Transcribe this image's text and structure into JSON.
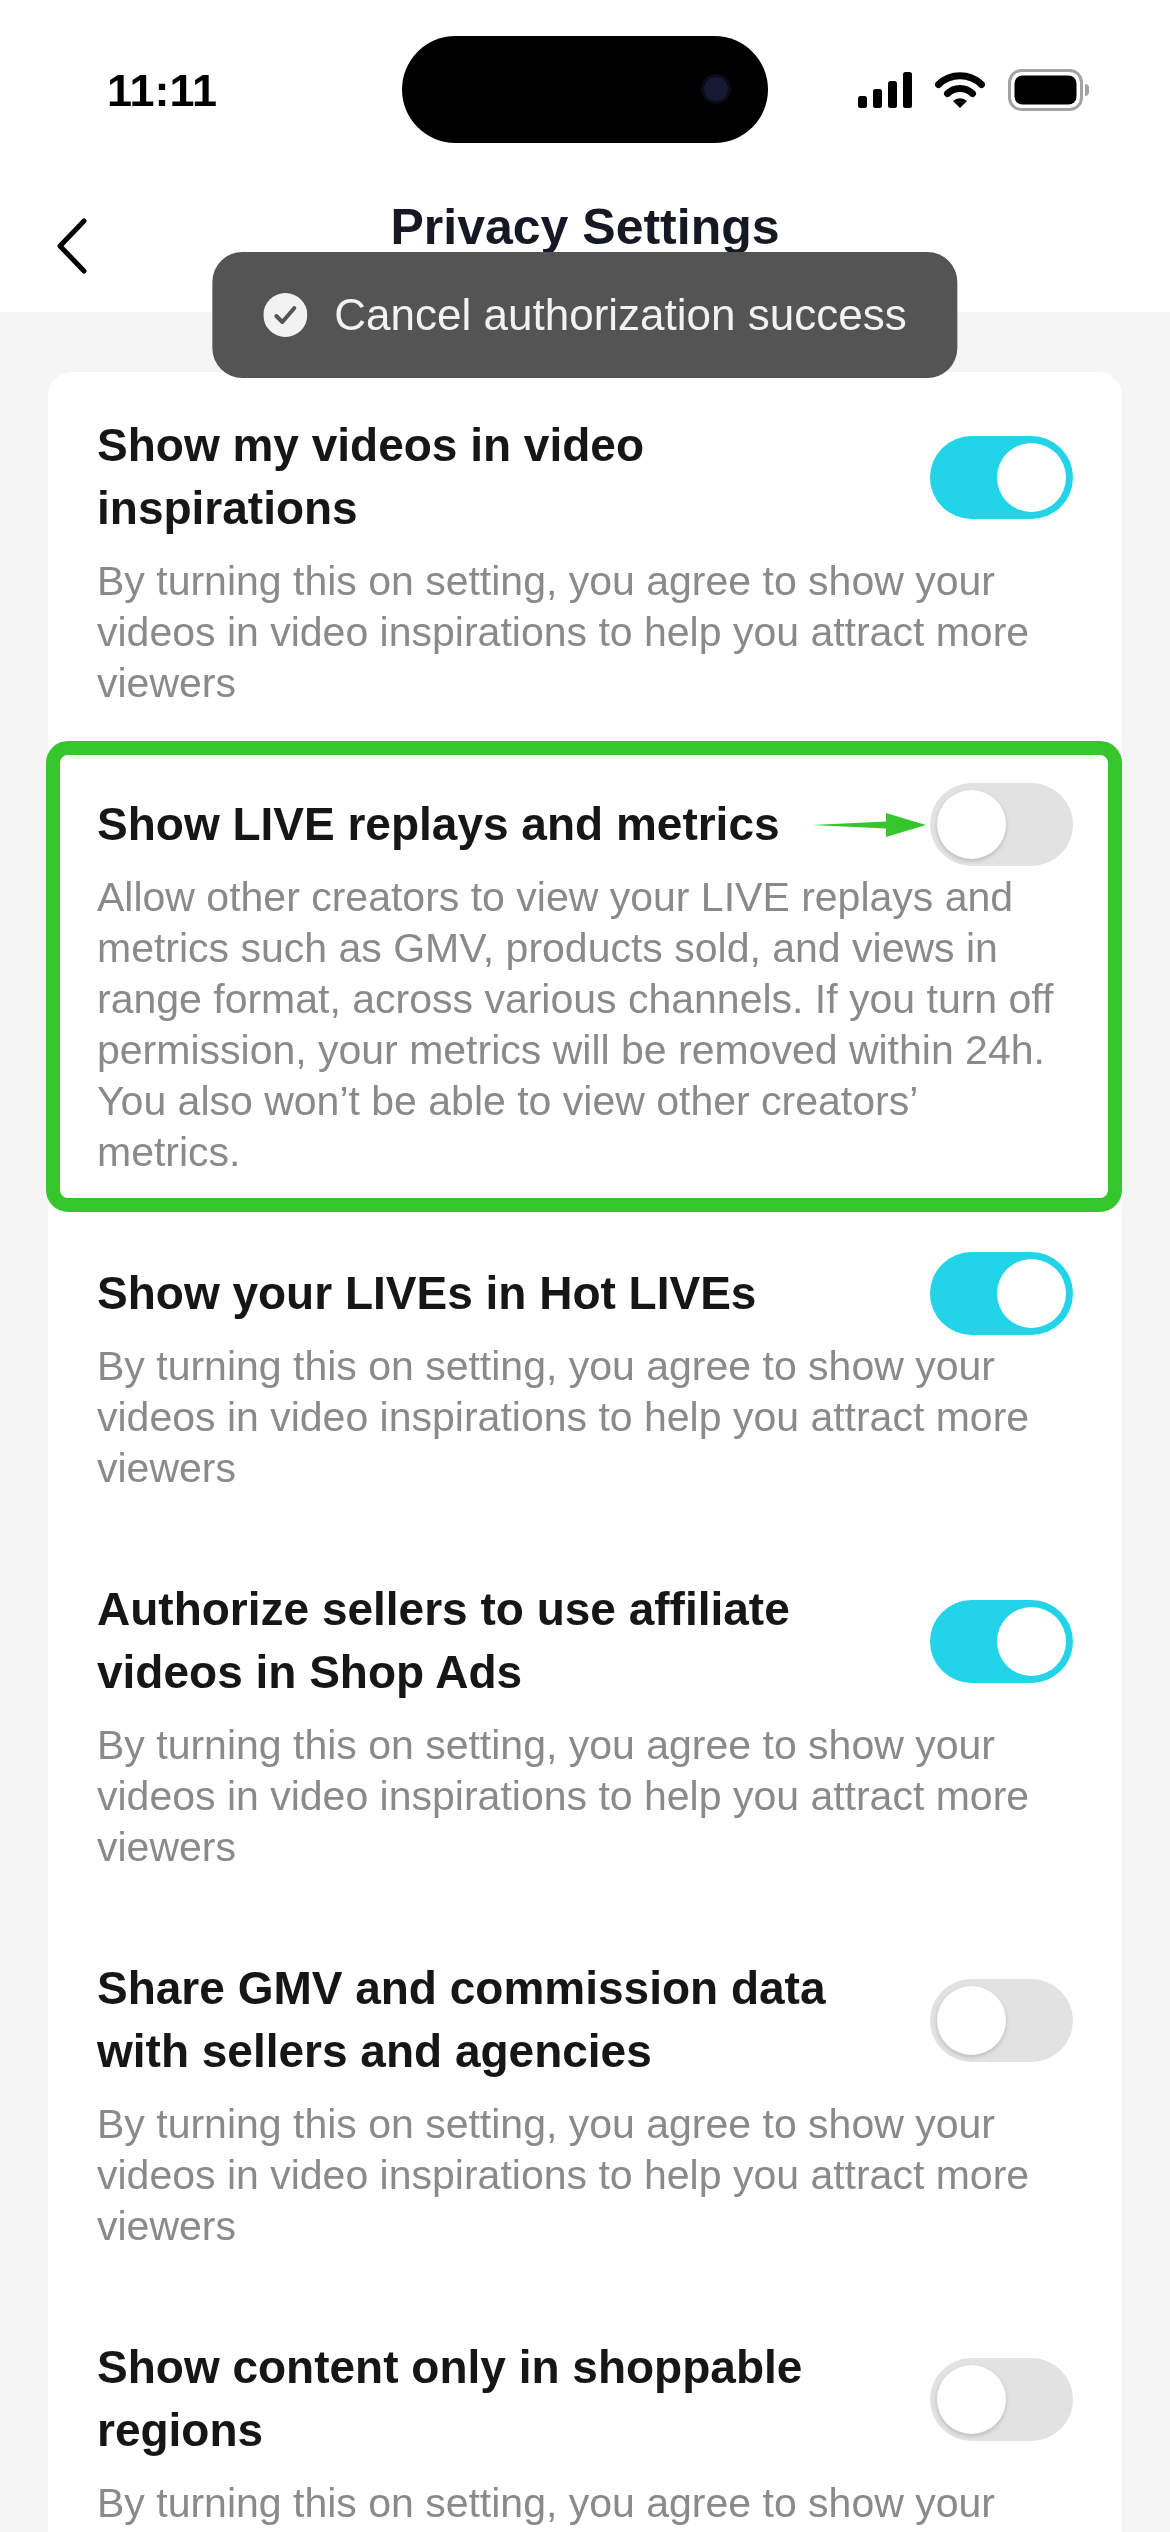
{
  "status_bar": {
    "time": "11:11"
  },
  "header": {
    "title": "Privacy Settings"
  },
  "toast": {
    "message": "Cancel authorization success"
  },
  "settings": [
    {
      "title": "Show my videos in video inspirations",
      "description": "By turning this on setting, you agree to show your videos in video inspirations to help you attract more viewers",
      "on": true,
      "highlighted": false
    },
    {
      "title": "Show LIVE replays and metrics",
      "description": "Allow other creators to view your LIVE replays and metrics such as GMV, products sold, and views in range format, across various channels. If you turn off permission, your metrics will be removed within 24h. You also won’t be able to view other creators’ metrics.",
      "on": false,
      "highlighted": true
    },
    {
      "title": "Show your LIVEs in Hot LIVEs",
      "description": "By turning this on setting, you agree to show your videos in video inspirations to help you attract more viewers",
      "on": true,
      "highlighted": false
    },
    {
      "title": "Authorize sellers to use affiliate videos in Shop Ads",
      "description": "By turning this on setting, you agree to show your videos in video inspirations to help you attract more viewers",
      "on": true,
      "highlighted": false
    },
    {
      "title": "Share GMV and commission data with sellers and agencies",
      "description": "By turning this on setting, you agree to show your videos in video inspirations to help you attract more viewers",
      "on": false,
      "highlighted": false
    },
    {
      "title": "Show content only in shoppable regions",
      "description": "By turning this on setting, you agree to show your",
      "on": false,
      "highlighted": false
    }
  ]
}
